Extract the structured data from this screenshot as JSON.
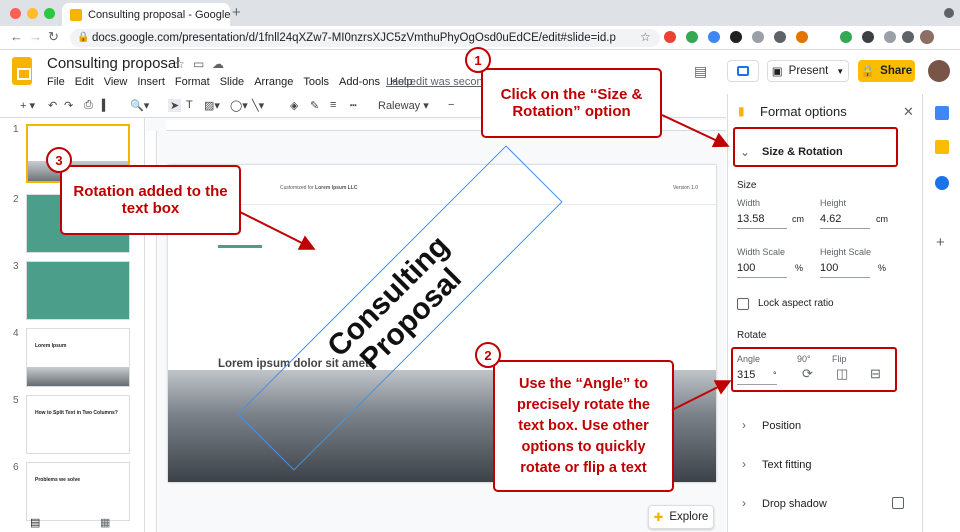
{
  "browser": {
    "tab_title": "Consulting proposal - Google S",
    "url": "docs.google.com/presentation/d/1fnll24qXZw7-MI0nzrsXJC5zVmthuPhyOgOsd0uEdCE/edit#slide=id.p",
    "new_tab_label": "+"
  },
  "app": {
    "doc_title": "Consulting proposal",
    "menus": [
      "File",
      "Edit",
      "View",
      "Insert",
      "Format",
      "Slide",
      "Arrange",
      "Tools",
      "Add-ons",
      "Help"
    ],
    "last_edit": "Last edit was seconds",
    "present_label": "Present",
    "share_label": "Share"
  },
  "toolbar": {
    "font": "Raleway"
  },
  "filmstrip": {
    "slide_numbers": [
      "1",
      "2",
      "3",
      "4",
      "5",
      "6"
    ],
    "thumb_texts": [
      "",
      "",
      "",
      "Lorem Ipsum",
      "How to Split Text in Two Columns?",
      "Problems we solve"
    ]
  },
  "slide": {
    "customized_for": "Customized for",
    "company": "Lorem Ipsum LLC",
    "version": "Version 1.0",
    "title_line1": "Consulting",
    "title_line2": "Proposal",
    "subtitle": "Lorem ipsum dolor sit amet."
  },
  "format_panel": {
    "title": "Format options",
    "size_rotation": "Size & Rotation",
    "size_heading": "Size",
    "width_label": "Width",
    "width_value": "13.58",
    "height_label": "Height",
    "height_value": "4.62",
    "unit": "cm",
    "width_scale_label": "Width Scale",
    "width_scale_value": "100",
    "height_scale_label": "Height Scale",
    "height_scale_value": "100",
    "percent": "%",
    "lock_aspect": "Lock aspect ratio",
    "rotate_heading": "Rotate",
    "angle_label": "Angle",
    "angle_value": "315",
    "degree": "°",
    "ninety_label": "90°",
    "flip_label": "Flip",
    "position": "Position",
    "text_fitting": "Text fitting",
    "drop_shadow": "Drop shadow"
  },
  "explore_label": "Explore",
  "callouts": {
    "c1_number": "1",
    "c1_text": "Click on the “Size & Rotation” option",
    "c2_number": "2",
    "c2_text": "Use the “Angle” to precisely rotate the text box. Use other options to quickly rotate or flip a text",
    "c3_number": "3",
    "c3_text": "Rotation added to the text box"
  },
  "colors": {
    "accent_red": "#c00000",
    "share_yellow": "#fbbc04",
    "selection_blue": "#4a90e2",
    "teal_slide": "#4a9e8a"
  }
}
